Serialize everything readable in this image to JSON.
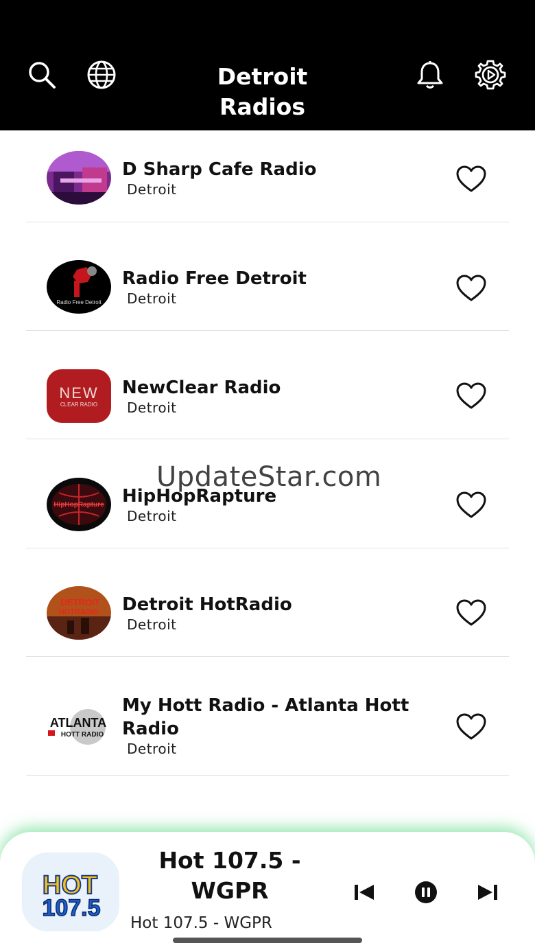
{
  "header": {
    "title_line1": "Detroit",
    "title_line2": "Radios",
    "icons": [
      "search-icon",
      "globe-icon",
      "bell-icon",
      "settings-icon"
    ]
  },
  "stations": [
    {
      "name": "D Sharp Cafe Radio",
      "location": "Detroit"
    },
    {
      "name": "Radio Free Detroit",
      "location": "Detroit"
    },
    {
      "name": "NewClear Radio",
      "location": "Detroit"
    },
    {
      "name": "HipHopRapture",
      "location": "Detroit"
    },
    {
      "name": "Detroit HotRadio",
      "location": "Detroit"
    },
    {
      "name": "My Hott Radio - Atlanta Hott Radio",
      "location": "Detroit"
    }
  ],
  "logos": {
    "radio_free_detroit": "Radio Free Detroit",
    "newclear_line1": "NEW",
    "newclear_line2": "CLEAR RADIO",
    "hiphop": "HipHopRapture",
    "detroit_hot_line1": "DETROIT",
    "detroit_hot_line2": "HOTRADIO",
    "atlanta_line1": "ATLANTA",
    "atlanta_line2": "HOTT RADIO",
    "hot_line1": "HOT",
    "hot_line2": "107.5"
  },
  "watermark": "UpdateStar.com",
  "now_playing": {
    "title_line1": "Hot 107.5 -",
    "title_line2": "WGPR",
    "subtitle": "Hot 107.5 - WGPR"
  },
  "colors": {
    "header_bg": "#000000",
    "player_glow": "#3cd26e",
    "divider": "#e2e2e2"
  }
}
